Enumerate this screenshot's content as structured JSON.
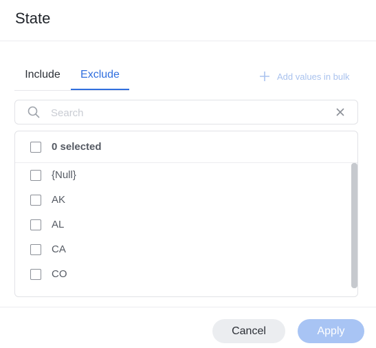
{
  "dialog": {
    "title": "State"
  },
  "tabs": [
    {
      "label": "Include",
      "active": false
    },
    {
      "label": "Exclude",
      "active": true
    }
  ],
  "bulk": {
    "label": "Add values in bulk",
    "icon": "plus-icon"
  },
  "search": {
    "placeholder": "Search",
    "value": "",
    "icon": "search-icon",
    "clear_icon": "close-icon"
  },
  "select_all": {
    "label": "0 selected",
    "checked": false
  },
  "items": [
    {
      "label": "{Null}",
      "checked": false
    },
    {
      "label": "AK",
      "checked": false
    },
    {
      "label": "AL",
      "checked": false
    },
    {
      "label": "CA",
      "checked": false
    },
    {
      "label": "CO",
      "checked": false
    }
  ],
  "footer": {
    "cancel_label": "Cancel",
    "apply_label": "Apply"
  },
  "colors": {
    "accent": "#2f6ede",
    "apply_disabled": "#a8c4f4",
    "muted_link": "#a9c2ee"
  }
}
